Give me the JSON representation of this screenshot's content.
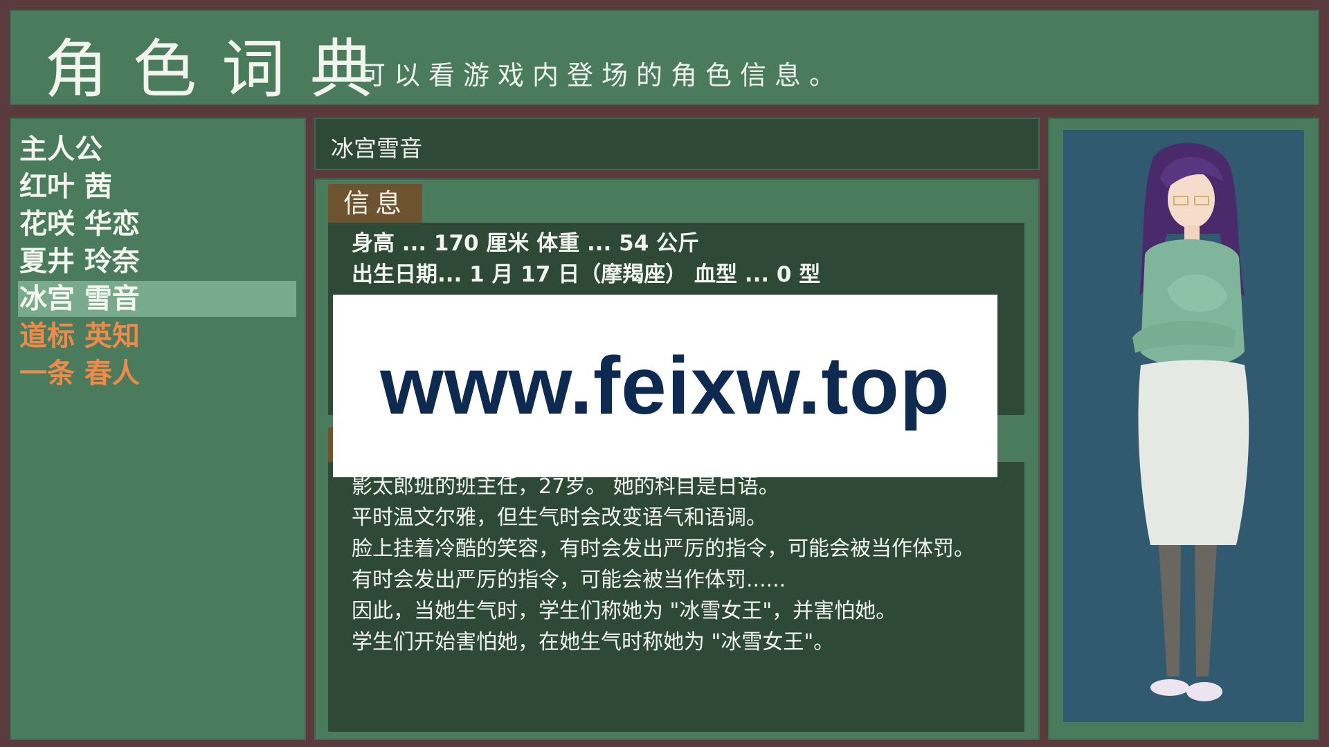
{
  "header": {
    "title": "角色词典",
    "subtitle": "可以看游戏内登场的角色信息。"
  },
  "sidebar": {
    "items": [
      {
        "label": "主人公"
      },
      {
        "label": "红叶 茜"
      },
      {
        "label": "花咲 华恋"
      },
      {
        "label": "夏井 玲奈"
      },
      {
        "label": "冰宫 雪音"
      },
      {
        "label": "道标 英知"
      },
      {
        "label": "一条 春人"
      }
    ],
    "selected_index": 4
  },
  "character": {
    "name": "冰宫雪音",
    "info_tab": "信息",
    "info_lines": [
      "身高 ... 170 厘米 体重 ... 54 公斤",
      "出生日期... 1 月 17 日（摩羯座） 血型 ... 0 型"
    ],
    "desc_lines": [
      "影太郎班的班主任，27岁。     她的科目是日语。",
      "平时温文尔雅，但生气时会改变语气和语调。",
      "脸上挂着冷酷的笑容，有时会发出严厉的指令，可能会被当作体罚。",
      "有时会发出严厉的指令，可能会被当作体罚......",
      "因此，当她生气时，学生们称她为 \"冰雪女王\"，并害怕她。",
      "学生们开始害怕她，在她生气时称她为 \"冰雪女王\"。"
    ]
  },
  "watermark": {
    "text": "www.feixw.top"
  },
  "colors": {
    "panel": "#4a7b5d",
    "dark_panel": "#2e4a37",
    "border": "#5a3a3c",
    "tab": "#6e5330",
    "locked_text": "#f08a4b",
    "portrait_bg": "#315a70"
  }
}
